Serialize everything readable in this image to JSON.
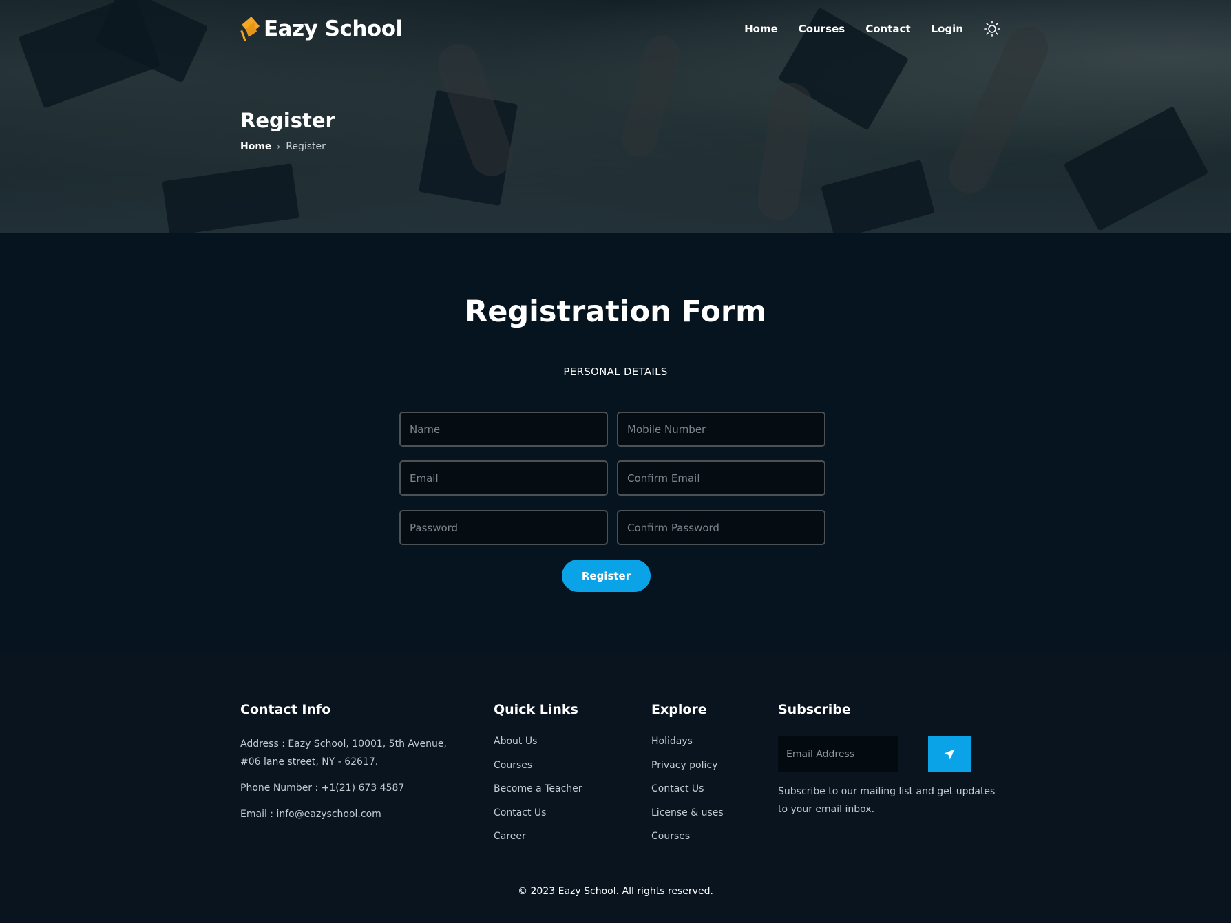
{
  "brand": {
    "name": "Eazy School",
    "icon": "graduation-cap-icon"
  },
  "nav": {
    "items": [
      {
        "label": "Home"
      },
      {
        "label": "Courses"
      },
      {
        "label": "Contact"
      },
      {
        "label": "Login"
      }
    ],
    "theme_toggle_icon": "sun-icon"
  },
  "hero": {
    "title": "Register",
    "breadcrumb": {
      "home": "Home",
      "separator": "›",
      "current": "Register"
    }
  },
  "form": {
    "title": "Registration Form",
    "section_label": "PERSONAL DETAILS",
    "fields": {
      "name": {
        "placeholder": "Name",
        "value": ""
      },
      "mobile": {
        "placeholder": "Mobile Number",
        "value": ""
      },
      "email": {
        "placeholder": "Email",
        "value": ""
      },
      "confirm_email": {
        "placeholder": "Confirm Email",
        "value": ""
      },
      "password": {
        "placeholder": "Password",
        "value": ""
      },
      "confirm_password": {
        "placeholder": "Confirm Password",
        "value": ""
      }
    },
    "submit_label": "Register"
  },
  "footer": {
    "contact": {
      "heading": "Contact Info",
      "address": "Address : Eazy School, 10001, 5th Avenue, #06 lane street, NY - 62617.",
      "phone": "Phone Number : +1(21) 673 4587",
      "email": "Email : info@eazyschool.com"
    },
    "quick_links": {
      "heading": "Quick Links",
      "items": [
        "About Us",
        "Courses",
        "Become a Teacher",
        "Contact Us",
        "Career"
      ]
    },
    "explore": {
      "heading": "Explore",
      "items": [
        "Holidays",
        "Privacy policy",
        "Contact Us",
        "License & uses",
        "Courses"
      ]
    },
    "subscribe": {
      "heading": "Subscribe",
      "placeholder": "Email Address",
      "button_icon": "paper-plane-icon",
      "text": "Subscribe to our mailing list and get updates to your email inbox."
    },
    "copyright": "© 2023 Eazy School. All rights reserved."
  },
  "colors": {
    "accent": "#0aa3e8",
    "logo_orange": "#f5a623",
    "background": "#05141e",
    "footer_background": "#09141f"
  }
}
